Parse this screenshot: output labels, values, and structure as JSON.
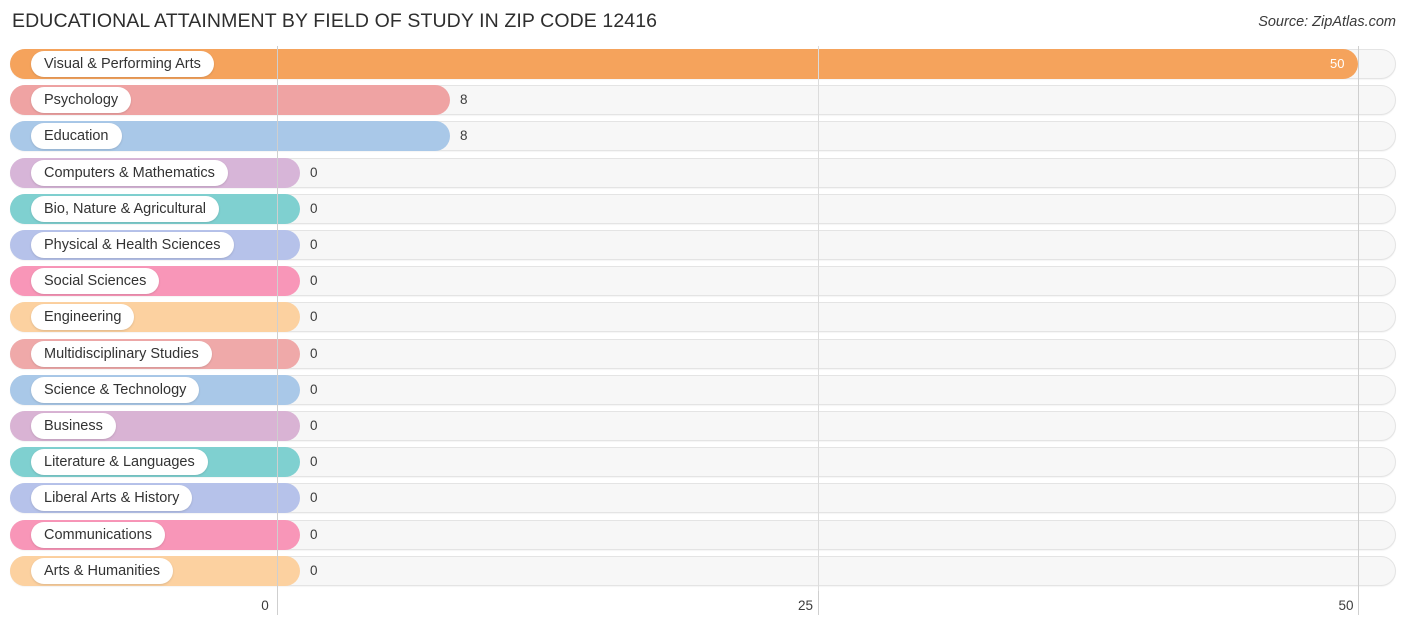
{
  "header": {
    "title": "EDUCATIONAL ATTAINMENT BY FIELD OF STUDY IN ZIP CODE 12416",
    "source": "Source: ZipAtlas.com"
  },
  "chart_data": {
    "type": "bar",
    "orientation": "horizontal",
    "title": "EDUCATIONAL ATTAINMENT BY FIELD OF STUDY IN ZIP CODE 12416",
    "xlabel": "",
    "ylabel": "",
    "xlim": [
      0,
      50
    ],
    "grid": true,
    "legend": "none",
    "ticks": [
      {
        "label": "0",
        "value": 0
      },
      {
        "label": "25",
        "value": 25
      },
      {
        "label": "50",
        "value": 50
      }
    ],
    "categories": [
      "Visual & Performing Arts",
      "Psychology",
      "Education",
      "Computers & Mathematics",
      "Bio, Nature & Agricultural",
      "Physical & Health Sciences",
      "Social Sciences",
      "Engineering",
      "Multidisciplinary Studies",
      "Science & Technology",
      "Business",
      "Literature & Languages",
      "Liberal Arts & History",
      "Communications",
      "Arts & Humanities"
    ],
    "values": [
      50,
      8,
      8,
      0,
      0,
      0,
      0,
      0,
      0,
      0,
      0,
      0,
      0,
      0,
      0
    ],
    "value_labels": [
      "50",
      "8",
      "8",
      "0",
      "0",
      "0",
      "0",
      "0",
      "0",
      "0",
      "0",
      "0",
      "0",
      "0",
      "0"
    ],
    "colors": [
      "#f5a35c",
      "#efa3a3",
      "#a9c8e8",
      "#d7b5d8",
      "#7fd0d0",
      "#b6c2ea",
      "#f896b8",
      "#fcd1a0",
      "#efa9a9",
      "#a9c8e8",
      "#d9b3d4",
      "#7fd0d0",
      "#b6c2ea",
      "#f896b8",
      "#fcd1a0"
    ]
  }
}
